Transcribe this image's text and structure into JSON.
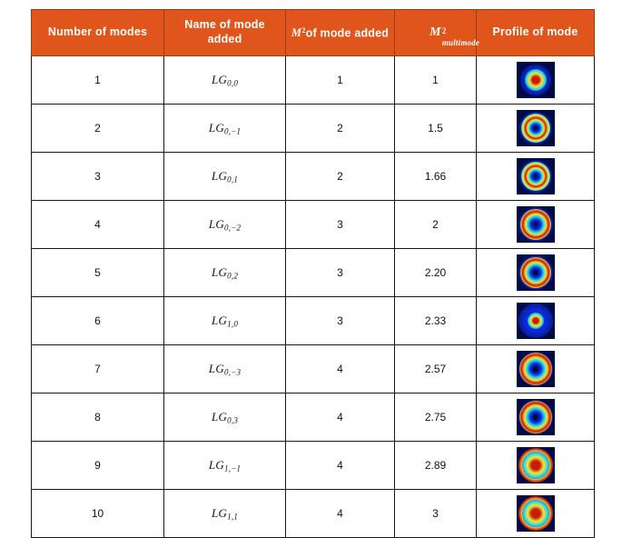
{
  "table": {
    "headers": [
      {
        "label": "Number of modes",
        "name": "header-number-of-modes"
      },
      {
        "label": "Name of mode added",
        "name": "header-name-of-mode-added"
      },
      {
        "label": "of mode added",
        "prefix": "M",
        "sup": "2",
        "name": "header-m2-of-mode-added"
      },
      {
        "label": "",
        "prefix": "M",
        "sup": "2",
        "sub": "multimode",
        "name": "header-m2-multimode"
      },
      {
        "label": "Profile of mode",
        "name": "header-profile-of-mode"
      }
    ],
    "rows": [
      {
        "number_of_modes": "1",
        "mode_base": "LG",
        "mode_sub": "0,0",
        "m2_of_mode_added": "1",
        "m2_multimode": "1",
        "profile": {
          "type": "gaussian-spot",
          "outer_radius": 15,
          "ring_radius": 0,
          "core_radius": 4,
          "halo_radius": 17
        }
      },
      {
        "number_of_modes": "2",
        "mode_base": "LG",
        "mode_sub": "0,−1",
        "m2_of_mode_added": "2",
        "m2_multimode": "1.5",
        "profile": {
          "type": "donut",
          "outer_radius": 16,
          "ring_radius": 8,
          "core_radius": 3,
          "halo_radius": 18
        }
      },
      {
        "number_of_modes": "3",
        "mode_base": "LG",
        "mode_sub": "0,1",
        "m2_of_mode_added": "2",
        "m2_multimode": "1.66",
        "profile": {
          "type": "donut",
          "outer_radius": 16,
          "ring_radius": 8,
          "core_radius": 3,
          "halo_radius": 18
        }
      },
      {
        "number_of_modes": "4",
        "mode_base": "LG",
        "mode_sub": "0,−2",
        "m2_of_mode_added": "3",
        "m2_multimode": "2",
        "profile": {
          "type": "donut",
          "outer_radius": 17,
          "ring_radius": 10,
          "core_radius": 4,
          "halo_radius": 19
        }
      },
      {
        "number_of_modes": "5",
        "mode_base": "LG",
        "mode_sub": "0,2",
        "m2_of_mode_added": "3",
        "m2_multimode": "2.20",
        "profile": {
          "type": "donut",
          "outer_radius": 17,
          "ring_radius": 10,
          "core_radius": 5,
          "halo_radius": 19
        }
      },
      {
        "number_of_modes": "6",
        "mode_base": "LG",
        "mode_sub": "1,0",
        "m2_of_mode_added": "3",
        "m2_multimode": "2.33",
        "profile": {
          "type": "core-halo",
          "outer_radius": 18,
          "ring_radius": 0,
          "core_radius": 3,
          "halo_radius": 19
        }
      },
      {
        "number_of_modes": "7",
        "mode_base": "LG",
        "mode_sub": "0,−3",
        "m2_of_mode_added": "4",
        "m2_multimode": "2.57",
        "profile": {
          "type": "donut",
          "outer_radius": 18,
          "ring_radius": 11,
          "core_radius": 6,
          "halo_radius": 19
        }
      },
      {
        "number_of_modes": "8",
        "mode_base": "LG",
        "mode_sub": "0,3",
        "m2_of_mode_added": "4",
        "m2_multimode": "2.75",
        "profile": {
          "type": "donut",
          "outer_radius": 18,
          "ring_radius": 11,
          "core_radius": 6,
          "halo_radius": 19
        }
      },
      {
        "number_of_modes": "9",
        "mode_base": "LG",
        "mode_sub": "1,−1",
        "m2_of_mode_added": "4",
        "m2_multimode": "2.89",
        "profile": {
          "type": "ringed-core",
          "outer_radius": 19,
          "ring_radius": 13,
          "core_radius": 5,
          "halo_radius": 19
        }
      },
      {
        "number_of_modes": "10",
        "mode_base": "LG",
        "mode_sub": "1,1",
        "m2_of_mode_added": "4",
        "m2_multimode": "3",
        "profile": {
          "type": "ringed-core",
          "outer_radius": 19,
          "ring_radius": 13,
          "core_radius": 5,
          "halo_radius": 19
        }
      }
    ]
  },
  "colors": {
    "header_background": "#e0551b",
    "header_text": "#ffffff",
    "border": "#1a1a1a",
    "profile_background": "#000a46",
    "profile_blue": "#0a2ad8",
    "profile_cyan": "#22d7e8",
    "profile_yellow": "#f2e63a",
    "profile_red": "#c81a08",
    "page_background": "#ffffff"
  }
}
